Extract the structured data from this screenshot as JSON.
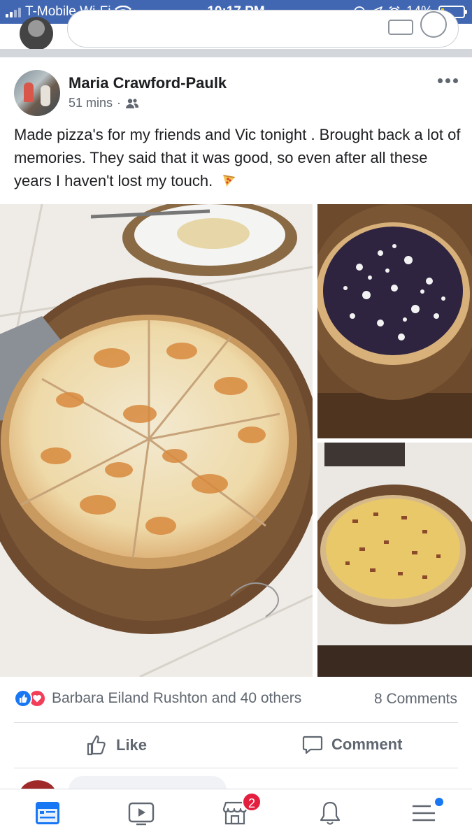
{
  "status_bar": {
    "carrier": "T-Mobile Wi-Fi",
    "time": "10:17 PM",
    "battery_percent": "14%",
    "battery_level": 0.14,
    "background_color": "#4267b2"
  },
  "post": {
    "author": "Maria Crawford-Paulk",
    "time_ago": "51 mins",
    "separator": "·",
    "audience_icon": "friends-icon",
    "text": "Made pizza's for my friends and Vic tonight . Brought back a lot of memories. They said that it was good, so even after all these years I haven't lost my touch.",
    "photos": [
      {
        "subject": "buffalo-chicken-pizza"
      },
      {
        "subject": "blueberry-pizza"
      },
      {
        "subject": "bacon-cheese-pizza"
      }
    ]
  },
  "engagement": {
    "reaction_icons": [
      "like-reaction-icon",
      "love-reaction-icon"
    ],
    "reactors_text": "Barbara Eiland Rushton and 40 others",
    "comments_text": "8 Comments"
  },
  "actions": {
    "like_label": "Like",
    "comment_label": "Comment"
  },
  "tabbar": {
    "items": [
      {
        "icon": "news-feed-icon",
        "active": true
      },
      {
        "icon": "watch-icon"
      },
      {
        "icon": "marketplace-icon",
        "badge": "2"
      },
      {
        "icon": "notifications-bell-icon"
      },
      {
        "icon": "menu-icon",
        "dot": true
      }
    ],
    "accent_color": "#1877f2"
  }
}
